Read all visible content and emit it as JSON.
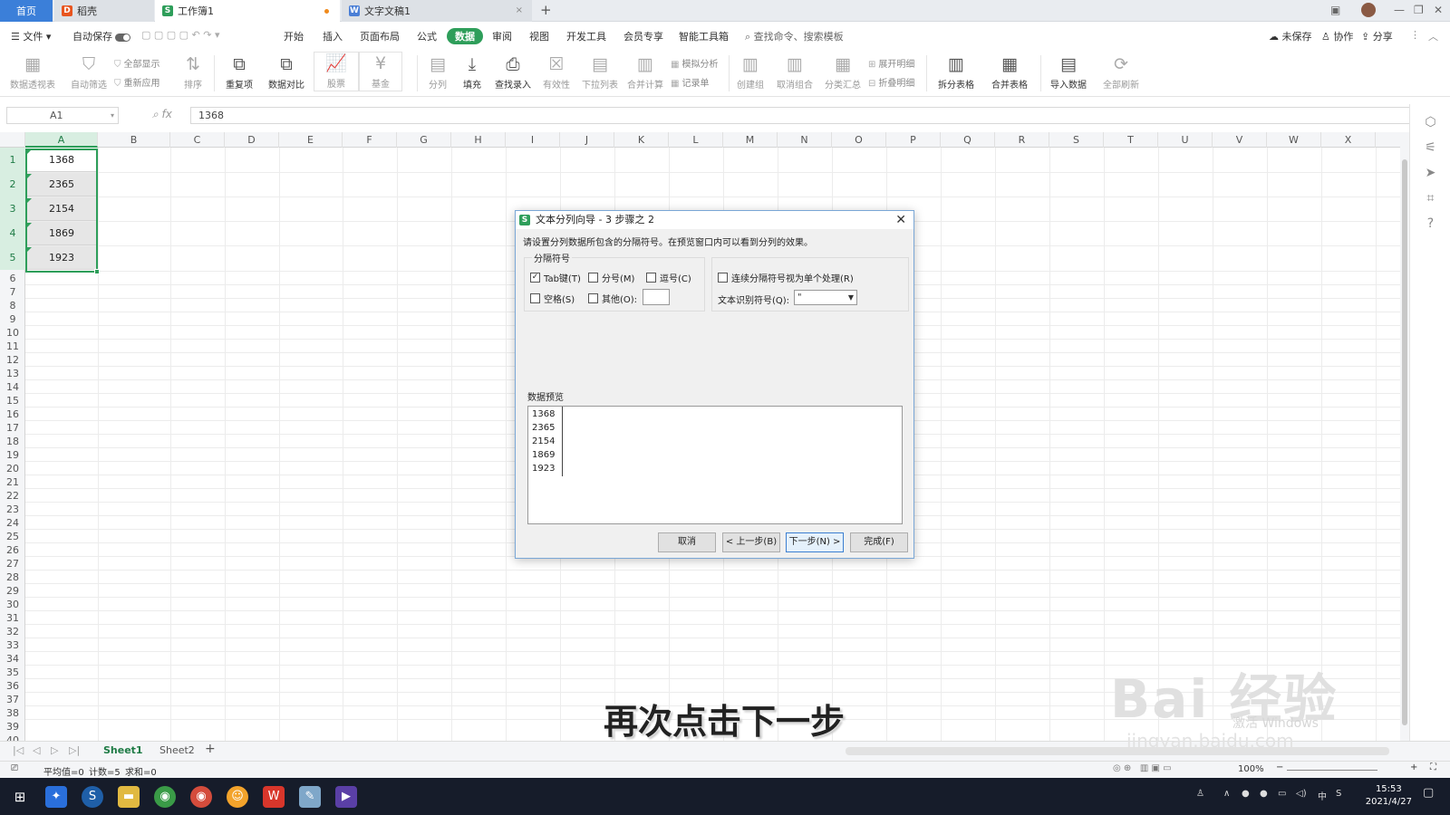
{
  "tabs": {
    "home": "首页",
    "t1": "稻壳",
    "t2": "工作簿1",
    "t3": "文字文稿1"
  },
  "menu": {
    "file": "文件",
    "autosave": "自动保存",
    "items": [
      "开始",
      "插入",
      "页面布局",
      "公式",
      "数据",
      "审阅",
      "视图",
      "开发工具",
      "会员专享",
      "智能工具箱"
    ],
    "active": "数据",
    "search": "查找命令、搜索模板",
    "unsaved": "未保存",
    "collab": "协作",
    "share": "分享"
  },
  "ribbon": {
    "pivot": "数据透视表",
    "autofilter": "自动筛选",
    "showall": "全部显示",
    "reapply": "重新应用",
    "sort": "排序",
    "duplicates": "重复项",
    "compare": "数据对比",
    "stock": "股票",
    "fund": "基金",
    "split": "分列",
    "fill": "填充",
    "lookup": "查找录入",
    "validity": "有效性",
    "dropdown": "下拉列表",
    "consolidate": "合并计算",
    "simulate": "模拟分析",
    "record": "记录单",
    "group": "创建组",
    "ungroup": "取消组合",
    "subtotal": "分类汇总",
    "expand": "展开明细",
    "collapse": "折叠明细",
    "splittable": "拆分表格",
    "mergetable": "合并表格",
    "import": "导入数据",
    "refresh": "全部刷新"
  },
  "formula": {
    "namebox": "A1",
    "value": "1368"
  },
  "columns": [
    "A",
    "B",
    "C",
    "D",
    "E",
    "F",
    "G",
    "H",
    "I",
    "J",
    "K",
    "L",
    "M",
    "N",
    "O",
    "P",
    "Q",
    "R",
    "S",
    "T",
    "U",
    "V",
    "W",
    "X"
  ],
  "rows": [
    "1",
    "2",
    "3",
    "4",
    "5",
    "6",
    "7",
    "8",
    "9",
    "10",
    "11",
    "12",
    "13",
    "14",
    "15",
    "16",
    "17",
    "18",
    "19",
    "20",
    "21",
    "22",
    "23",
    "24",
    "25",
    "26",
    "27",
    "28",
    "29",
    "30",
    "31",
    "32",
    "33",
    "34",
    "35",
    "36",
    "37",
    "38",
    "39",
    "40"
  ],
  "cells": [
    "1368",
    "2365",
    "2154",
    "1869",
    "1923"
  ],
  "sheets": [
    "Sheet1",
    "Sheet2"
  ],
  "status": {
    "avg": "平均值=0",
    "count": "计数=5",
    "sum": "求和=0",
    "zoom": "100%"
  },
  "taskbar": {
    "time": "15:53",
    "date": "2021/4/27",
    "ime": "中"
  },
  "dialog": {
    "title": "文本分列向导 - 3 步骤之 2",
    "instruction": "请设置分列数据所包含的分隔符号。在预览窗口内可以看到分列的效果。",
    "group_label": "分隔符号",
    "tab": "Tab键(T)",
    "semicolon": "分号(M)",
    "comma": "逗号(C)",
    "space": "空格(S)",
    "other": "其他(O):",
    "consecutive": "连续分隔符号视为单个处理(R)",
    "qualifier_label": "文本识别符号(Q):",
    "qualifier_value": "\"",
    "preview_label": "数据预览",
    "preview": [
      "1368",
      "2365",
      "2154",
      "1869",
      "1923"
    ],
    "cancel": "取消",
    "back": "< 上一步(B)",
    "next": "下一步(N) >",
    "finish": "完成(F)"
  },
  "caption": "再次点击下一步",
  "watermark": {
    "brand": "Bai 经验",
    "url": "jingyan.baidu.com",
    "activate": "激活 Windows"
  }
}
